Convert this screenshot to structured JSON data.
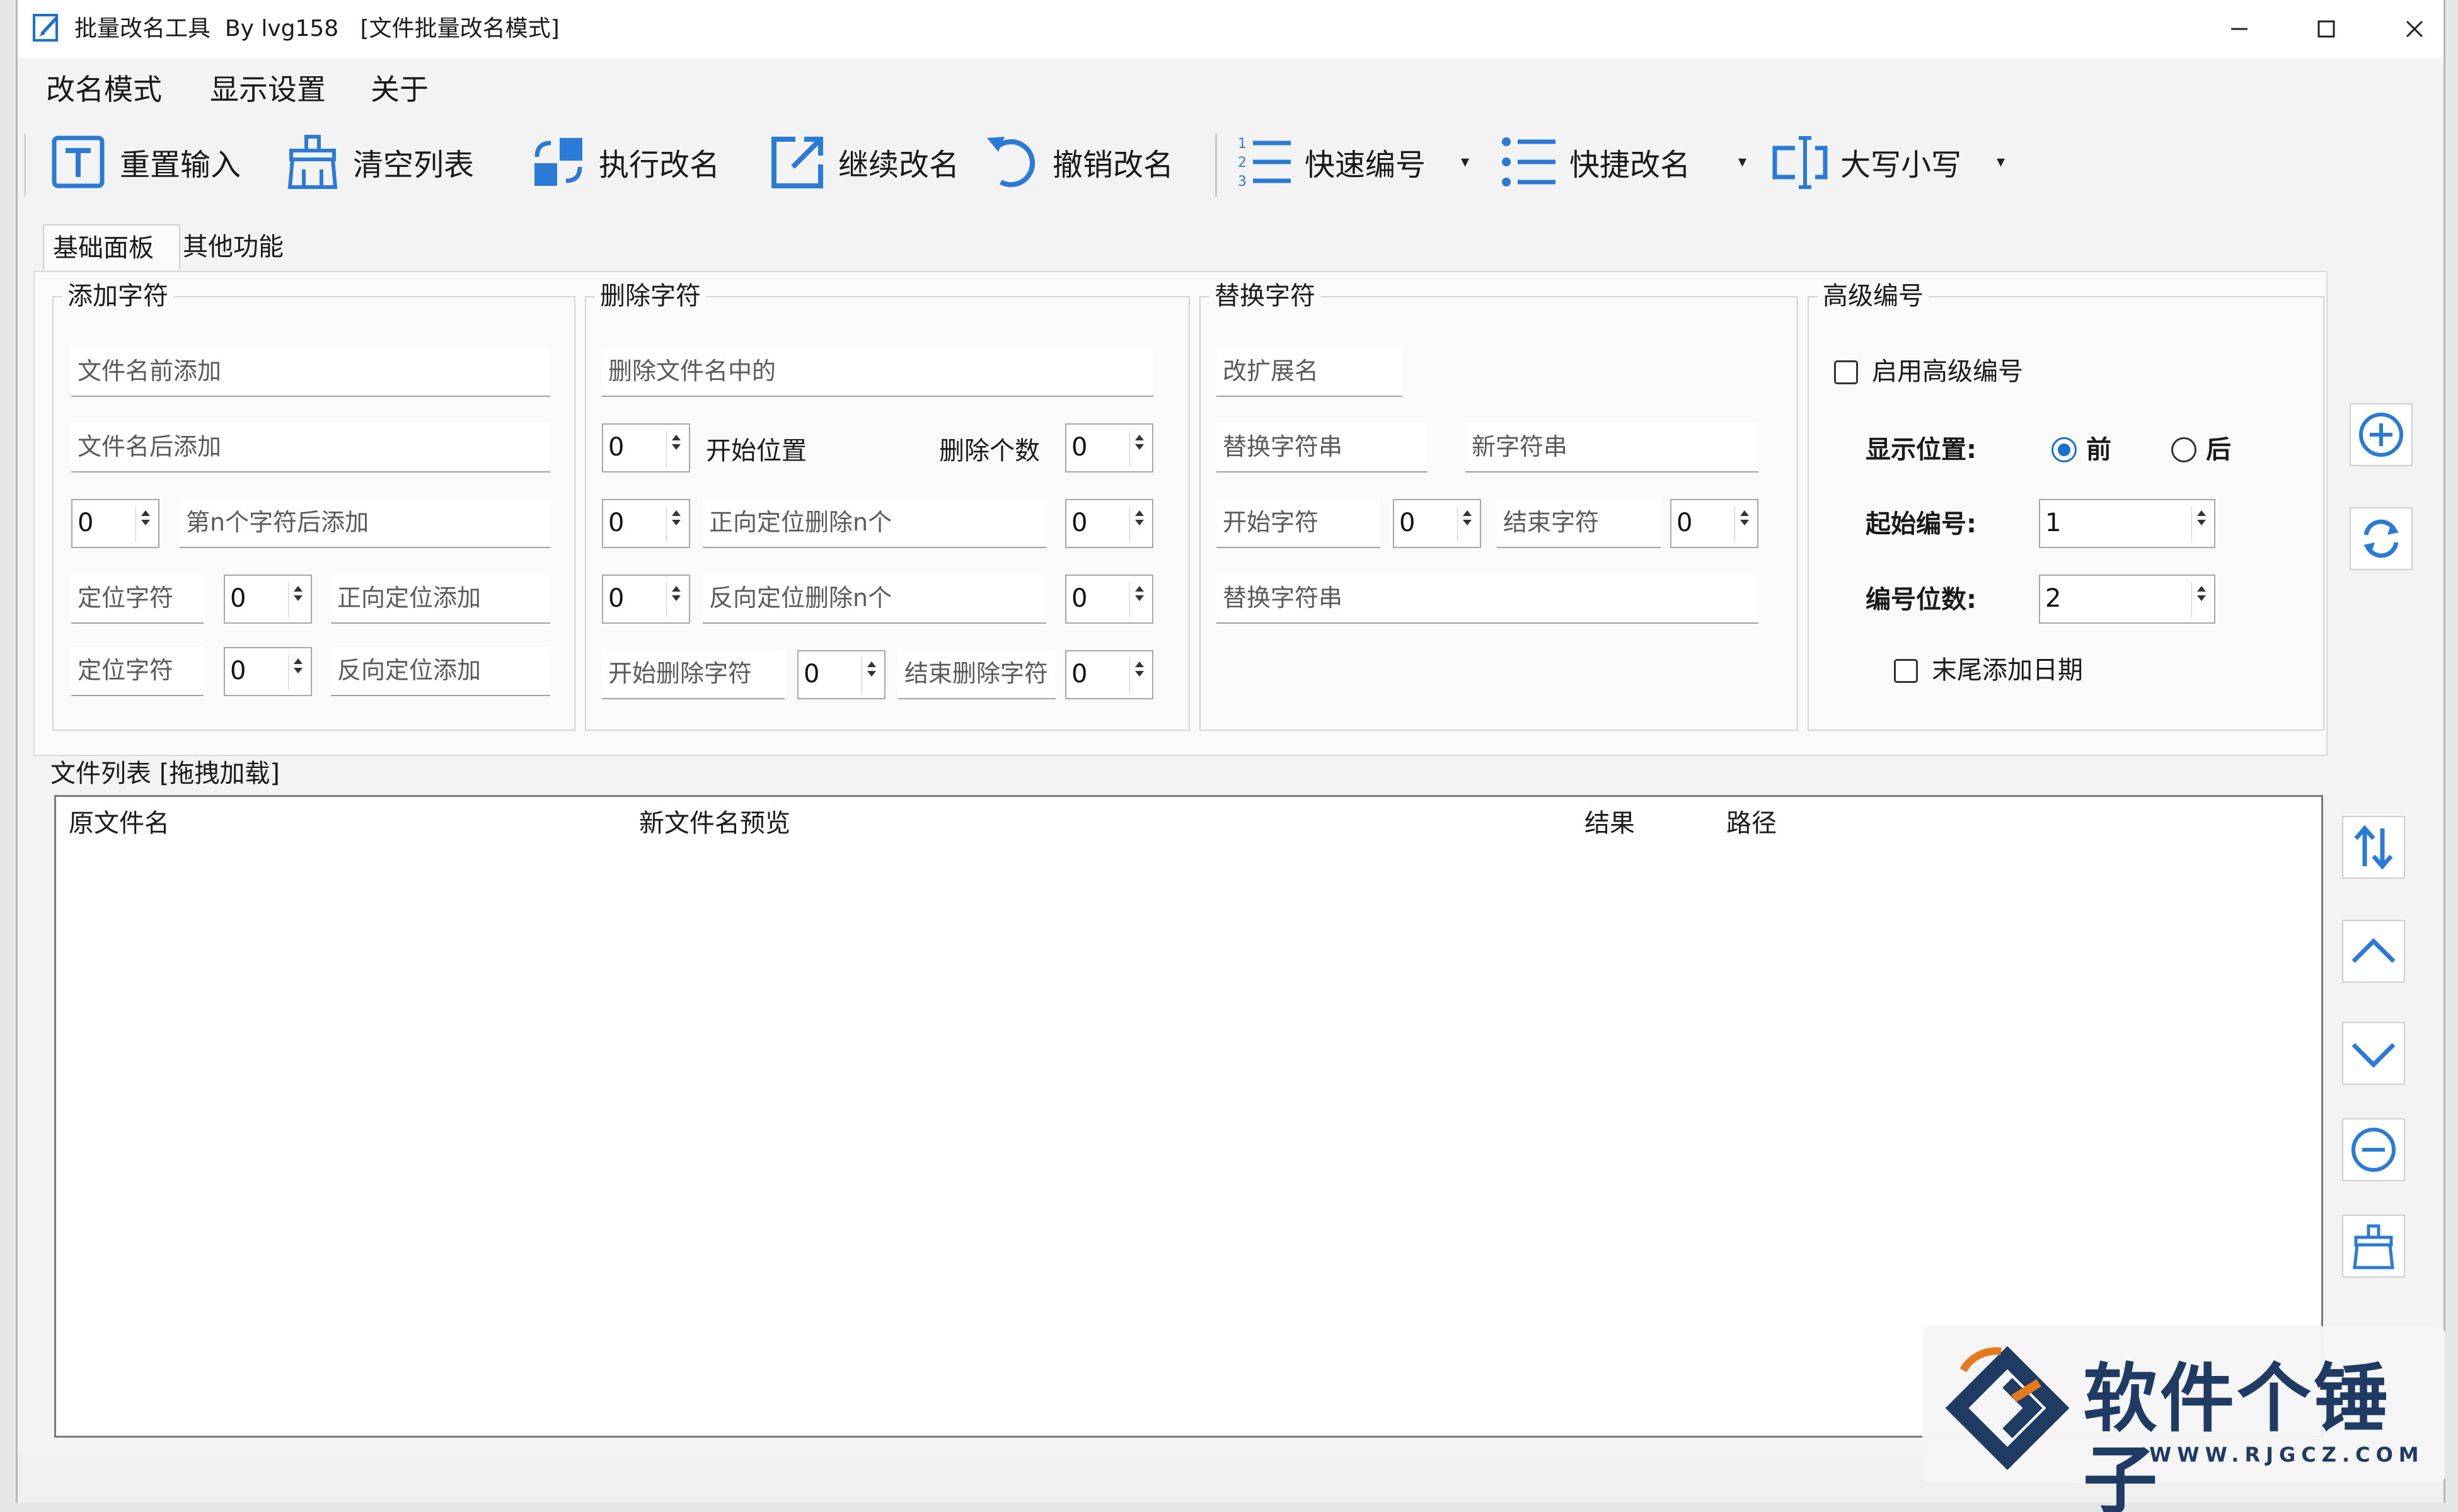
{
  "window": {
    "title": "批量改名工具  By lvg158   [文件批量改名模式]",
    "controls": {
      "minimize": "—",
      "maximize": "☐",
      "close": "✕"
    }
  },
  "menu": [
    "改名模式",
    "显示设置",
    "关于"
  ],
  "toolbar": {
    "reset_input": "重置输入",
    "clear_list": "清空列表",
    "execute_rename": "执行改名",
    "continue_rename": "继续改名",
    "undo_rename": "撤销改名",
    "quick_number": "快速编号",
    "quick_rename": "快捷改名",
    "upper_lower": "大写小写"
  },
  "tabs": {
    "basic": "基础面板",
    "other": "其他功能"
  },
  "add_chars": {
    "title": "添加字符",
    "prefix_placeholder": "文件名前添加",
    "suffix_placeholder": "文件名后添加",
    "nth_value": "0",
    "nth_placeholder": "第n个字符后添加",
    "locate1_placeholder": "定位字符",
    "locate1_value": "0",
    "forward_add_placeholder": "正向定位添加",
    "locate2_placeholder": "定位字符",
    "locate2_value": "0",
    "reverse_add_placeholder": "反向定位添加"
  },
  "delete_chars": {
    "title": "删除字符",
    "contains_placeholder": "删除文件名中的",
    "start_pos_value": "0",
    "start_pos_label": "开始位置",
    "count_label": "删除个数",
    "count_value": "0",
    "fwd_pos_value": "0",
    "fwd_del_placeholder": "正向定位删除n个",
    "fwd_n_value": "0",
    "rev_pos_value": "0",
    "rev_del_placeholder": "反向定位删除n个",
    "rev_n_value": "0",
    "start_char_placeholder": "开始删除字符",
    "start_char_value": "0",
    "end_char_placeholder": "结束删除字符",
    "end_char_value": "0"
  },
  "replace_chars": {
    "title": "替换字符",
    "ext_placeholder": "改扩展名",
    "old_placeholder": "替换字符串",
    "new_placeholder": "新字符串",
    "start_char_placeholder": "开始字符",
    "start_value": "0",
    "end_char_placeholder": "结束字符",
    "end_value": "0",
    "replace_str_placeholder": "替换字符串"
  },
  "adv_number": {
    "title": "高级编号",
    "enable_label": "启用高级编号",
    "position_label": "显示位置:",
    "pos_front": "前",
    "pos_back": "后",
    "start_label": "起始编号:",
    "start_value": "1",
    "digits_label": "编号位数:",
    "digits_value": "2",
    "date_label": "末尾添加日期"
  },
  "file_list": {
    "title": "文件列表 [拖拽加载]",
    "columns": [
      "原文件名",
      "新文件名预览",
      "结果",
      "路径"
    ]
  },
  "watermark": {
    "name": "软件个锤子",
    "url": "WWW.RJGCZ.COM"
  },
  "colors": {
    "accent": "#1a6fd1",
    "icon": "#2b7bd6"
  }
}
